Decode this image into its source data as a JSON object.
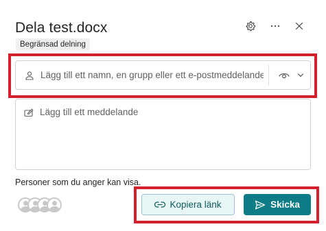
{
  "dialog": {
    "title": "Dela test.docx",
    "badge": "Begränsad delning"
  },
  "header": {
    "settings_icon": "gear-icon",
    "more_icon": "more-horizontal-icon",
    "close_icon": "close-icon"
  },
  "people_field": {
    "placeholder": "Lägg till ett namn, en grupp eller ett e-postmeddelande",
    "value": "",
    "leading_icon": "person-icon",
    "permission_icon": "eye-icon",
    "dropdown_icon": "chevron-down-icon"
  },
  "message_field": {
    "placeholder": "Lägg till ett meddelande",
    "value": "",
    "icon": "edit-icon"
  },
  "info_text": "Personer som du anger kan visa.",
  "actions": {
    "copy_link_label": "Kopiera länk",
    "copy_link_icon": "link-icon",
    "send_label": "Skicka",
    "send_icon": "send-icon"
  },
  "colors": {
    "highlight": "#d4202c",
    "primary": "#0e7c86",
    "secondary_bg": "#e8f6f6",
    "secondary_text": "#0e5d5d"
  }
}
